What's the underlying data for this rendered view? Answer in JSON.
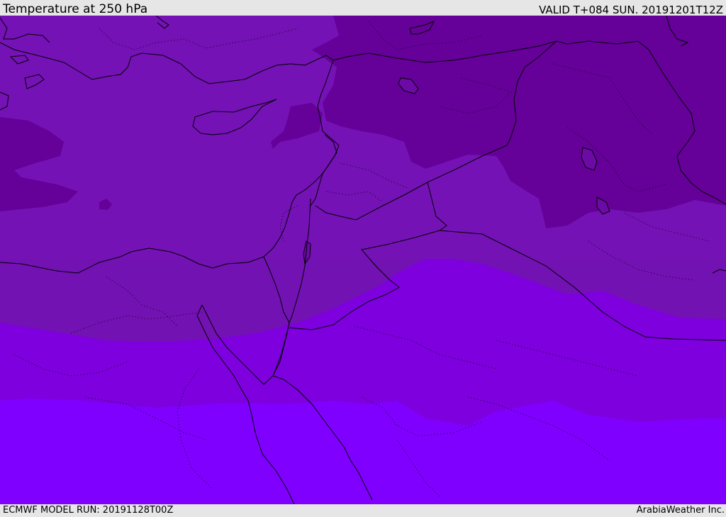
{
  "header": {
    "title": "Temperature at 250 hPa",
    "valid": "VALID T+084 SUN. 20191201T12Z"
  },
  "footer": {
    "model_run": "ECMWF MODEL RUN: 20191128T00Z",
    "credit": "ArabiaWeather Inc."
  },
  "map": {
    "field": "temperature",
    "pressure_level": "250 hPa",
    "colors": {
      "band_coldest": "#5f0099",
      "band_cold": "#7210b0",
      "band_mid": "#8000d8",
      "band_warm": "#8000ff",
      "coastline": "#000000",
      "borders": "#000000"
    },
    "icons": [
      "coastline-lines",
      "country-borders",
      "province-dotted-lines"
    ]
  }
}
